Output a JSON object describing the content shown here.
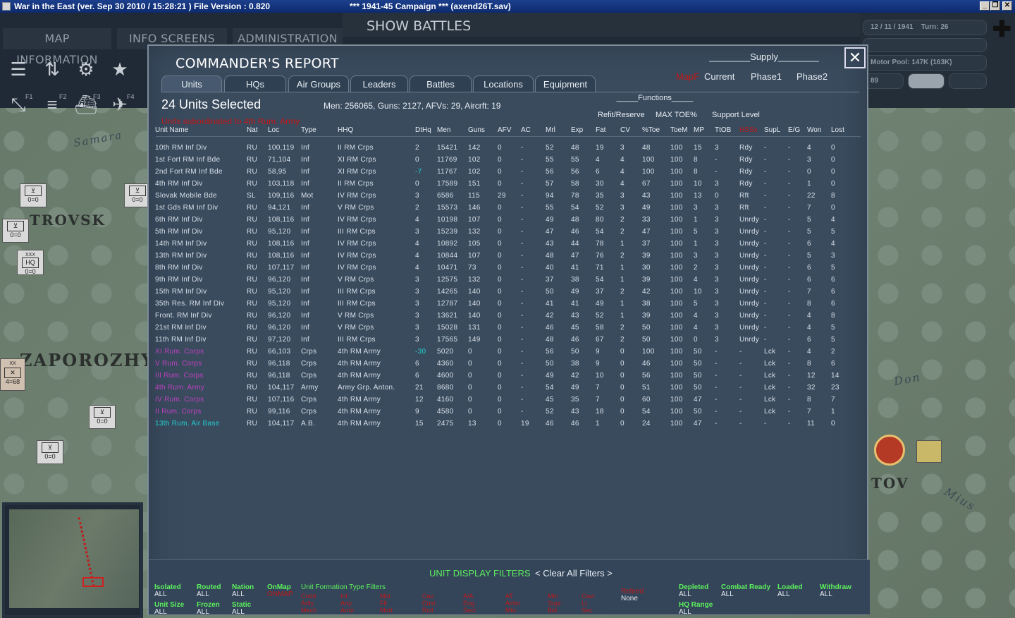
{
  "window": {
    "title": "War in the East (ver. Sep 30 2010 / 15:28:21 )   File Version : 0.820",
    "subtitle": "***   1941-45 Campaign   ***    (axend26T.sav)"
  },
  "nav": {
    "map_info": "MAP INFORMATION",
    "info_screens": "INFO SCREENS",
    "administration": "ADMINISTRATION",
    "show_battles": "SHOW BATTLES"
  },
  "status": {
    "date": "12 / 11 / 1941",
    "turn": "Turn: 26",
    "motor_pool": "Motor Pool: 147K (163K)",
    "value89": "89"
  },
  "function_keys": [
    "F1",
    "F2",
    "F3",
    "F4"
  ],
  "map": {
    "labels": [
      "Samara",
      "TROVSK",
      "ZAPOROZHY",
      "Don",
      "TOV",
      "Mius"
    ],
    "counters": [
      "0=0",
      "0=0",
      "0=0",
      "0=0",
      "0=0",
      "0=0",
      "4=68"
    ],
    "counter_codes": [
      "XXX",
      "HQ",
      "XX"
    ]
  },
  "dialog": {
    "title": "COMMANDER'S REPORT",
    "close": "✕",
    "supply_header": "________Supply________",
    "supply_options": {
      "mapf": "MapF",
      "current": "Current",
      "phase1": "Phase1",
      "phase2": "Phase2"
    },
    "tabs": [
      "Units",
      "HQs",
      "Air Groups",
      "Leaders",
      "Battles",
      "Locations",
      "Equipment"
    ],
    "selected_count": "24 Units Selected",
    "summary": "Men: 256065, Guns: 2127, AFVs: 29, Aircrft: 19",
    "red_message": "Units subordinated to 4th Rum. Army",
    "functions_header": "_____Functions_____",
    "group_headers": {
      "refit": "Refit/Reserve",
      "maxtoe": "MAX TOE%",
      "support": "Support Level"
    },
    "columns": [
      "Unit Name",
      "Nat",
      "Loc",
      "Type",
      "HHQ",
      "DtHq",
      "Men",
      "Guns",
      "AFV",
      "AC",
      "Mrl",
      "Exp",
      "Fat",
      "CV",
      "%Toe",
      "ToeM",
      "MP",
      "TtOB",
      "HSSx",
      "SupL",
      "E/G",
      "Won",
      "Lost"
    ]
  },
  "units": [
    [
      "10th RM Inf Div",
      "RU",
      "100,119",
      "Inf",
      "II RM Crps",
      "2",
      "15421",
      "142",
      "0",
      "-",
      "52",
      "48",
      "19",
      "3",
      "48",
      "100",
      "15",
      "3",
      "Rdy",
      "-",
      "-",
      "4",
      "0"
    ],
    [
      "1st Fort RM Inf Bde",
      "RU",
      "71,104",
      "Inf",
      "XI RM Crps",
      "0",
      "11769",
      "102",
      "0",
      "-",
      "55",
      "55",
      "4",
      "4",
      "100",
      "100",
      "8",
      "-",
      "Rdy",
      "-",
      "-",
      "3",
      "0"
    ],
    [
      "2nd Fort RM Inf Bde",
      "RU",
      "58,95",
      "Inf",
      "XI RM Crps",
      "-7",
      "11767",
      "102",
      "0",
      "-",
      "56",
      "56",
      "6",
      "4",
      "100",
      "100",
      "8",
      "-",
      "Rdy",
      "-",
      "-",
      "0",
      "0"
    ],
    [
      "4th RM Inf Div",
      "RU",
      "103,118",
      "Inf",
      "II RM Crps",
      "0",
      "17589",
      "151",
      "0",
      "-",
      "57",
      "58",
      "30",
      "4",
      "67",
      "100",
      "10",
      "3",
      "Rdy",
      "-",
      "-",
      "1",
      "0"
    ],
    [
      "Slovak Mobile Bde",
      "SL",
      "109,116",
      "Mot",
      "IV RM Crps",
      "3",
      "6586",
      "115",
      "29",
      "-",
      "94",
      "78",
      "35",
      "3",
      "43",
      "100",
      "13",
      "0",
      "Rft",
      "-",
      "-",
      "22",
      "8"
    ],
    [
      "1st Gds RM Inf Div",
      "RU",
      "94,121",
      "Inf",
      "V RM Crps",
      "2",
      "15573",
      "146",
      "0",
      "-",
      "55",
      "54",
      "52",
      "3",
      "49",
      "100",
      "3",
      "3",
      "Rft",
      "-",
      "-",
      "7",
      "0"
    ],
    [
      "6th RM Inf Div",
      "RU",
      "108,116",
      "Inf",
      "IV RM Crps",
      "4",
      "10198",
      "107",
      "0",
      "-",
      "49",
      "48",
      "80",
      "2",
      "33",
      "100",
      "1",
      "3",
      "Unrdy",
      "-",
      "-",
      "5",
      "4"
    ],
    [
      "5th RM Inf Div",
      "RU",
      "95,120",
      "Inf",
      "III RM Crps",
      "3",
      "15239",
      "132",
      "0",
      "-",
      "47",
      "46",
      "54",
      "2",
      "47",
      "100",
      "5",
      "3",
      "Unrdy",
      "-",
      "-",
      "5",
      "5"
    ],
    [
      "14th RM Inf Div",
      "RU",
      "108,116",
      "Inf",
      "IV RM Crps",
      "4",
      "10892",
      "105",
      "0",
      "-",
      "43",
      "44",
      "78",
      "1",
      "37",
      "100",
      "1",
      "3",
      "Unrdy",
      "-",
      "-",
      "6",
      "4"
    ],
    [
      "13th RM Inf Div",
      "RU",
      "108,116",
      "Inf",
      "IV RM Crps",
      "4",
      "10844",
      "107",
      "0",
      "-",
      "48",
      "47",
      "76",
      "2",
      "39",
      "100",
      "3",
      "3",
      "Unrdy",
      "-",
      "-",
      "5",
      "3"
    ],
    [
      "8th RM Inf Div",
      "RU",
      "107,117",
      "Inf",
      "IV RM Crps",
      "4",
      "10471",
      "73",
      "0",
      "-",
      "40",
      "41",
      "71",
      "1",
      "30",
      "100",
      "2",
      "3",
      "Unrdy",
      "-",
      "-",
      "6",
      "5"
    ],
    [
      "9th RM Inf Div",
      "RU",
      "96,120",
      "Inf",
      "V RM Crps",
      "3",
      "12575",
      "132",
      "0",
      "-",
      "37",
      "38",
      "54",
      "1",
      "39",
      "100",
      "4",
      "3",
      "Unrdy",
      "-",
      "-",
      "6",
      "6"
    ],
    [
      "15th RM Inf Div",
      "RU",
      "95,120",
      "Inf",
      "III RM Crps",
      "3",
      "14265",
      "140",
      "0",
      "-",
      "50",
      "49",
      "37",
      "2",
      "42",
      "100",
      "10",
      "3",
      "Unrdy",
      "-",
      "-",
      "7",
      "6"
    ],
    [
      "35th Res. RM Inf Div",
      "RU",
      "95,120",
      "Inf",
      "III RM Crps",
      "3",
      "12787",
      "140",
      "0",
      "-",
      "41",
      "41",
      "49",
      "1",
      "38",
      "100",
      "5",
      "3",
      "Unrdy",
      "-",
      "-",
      "8",
      "6"
    ],
    [
      "Front. RM Inf Div",
      "RU",
      "96,120",
      "Inf",
      "V RM Crps",
      "3",
      "13621",
      "140",
      "0",
      "-",
      "42",
      "43",
      "52",
      "1",
      "39",
      "100",
      "4",
      "3",
      "Unrdy",
      "-",
      "-",
      "4",
      "8"
    ],
    [
      "21st RM Inf Div",
      "RU",
      "96,120",
      "Inf",
      "V RM Crps",
      "3",
      "15028",
      "131",
      "0",
      "-",
      "46",
      "45",
      "58",
      "2",
      "50",
      "100",
      "4",
      "3",
      "Unrdy",
      "-",
      "-",
      "4",
      "5"
    ],
    [
      "11th RM Inf Div",
      "RU",
      "97,120",
      "Inf",
      "III RM Crps",
      "3",
      "17565",
      "149",
      "0",
      "-",
      "48",
      "46",
      "67",
      "2",
      "50",
      "100",
      "0",
      "3",
      "Unrdy",
      "-",
      "-",
      "6",
      "5"
    ],
    [
      "XI Rum. Corps",
      "RU",
      "66,103",
      "Crps",
      "4th RM Army",
      "-30",
      "5020",
      "0",
      "0",
      "-",
      "56",
      "50",
      "9",
      "0",
      "100",
      "100",
      "50",
      "-",
      "-",
      "Lck",
      "-",
      "4",
      "2"
    ],
    [
      "V Rum. Corps",
      "RU",
      "96,118",
      "Crps",
      "4th RM Army",
      "6",
      "4360",
      "0",
      "0",
      "-",
      "50",
      "38",
      "9",
      "0",
      "46",
      "100",
      "50",
      "-",
      "-",
      "Lck",
      "-",
      "8",
      "6"
    ],
    [
      "III Rum. Corps",
      "RU",
      "96,118",
      "Crps",
      "4th RM Army",
      "6",
      "4600",
      "0",
      "0",
      "-",
      "49",
      "42",
      "10",
      "0",
      "56",
      "100",
      "50",
      "-",
      "-",
      "Lck",
      "-",
      "12",
      "14"
    ],
    [
      "4th Rum. Army",
      "RU",
      "104,117",
      "Army",
      "Army Grp. Anton.",
      "21",
      "8680",
      "0",
      "0",
      "-",
      "54",
      "49",
      "7",
      "0",
      "51",
      "100",
      "50",
      "-",
      "-",
      "Lck",
      "-",
      "32",
      "23"
    ],
    [
      "IV Rum. Corps",
      "RU",
      "107,116",
      "Crps",
      "4th RM Army",
      "12",
      "4160",
      "0",
      "0",
      "-",
      "45",
      "35",
      "7",
      "0",
      "60",
      "100",
      "47",
      "-",
      "-",
      "Lck",
      "-",
      "8",
      "7"
    ],
    [
      "II Rum. Corps",
      "RU",
      "99,116",
      "Crps",
      "4th RM Army",
      "9",
      "4580",
      "0",
      "0",
      "-",
      "52",
      "43",
      "18",
      "0",
      "54",
      "100",
      "50",
      "-",
      "-",
      "Lck",
      "-",
      "7",
      "1"
    ],
    [
      "13th Rum. Air Base",
      "RU",
      "104,117",
      "A.B.",
      "4th RM Army",
      "15",
      "2475",
      "13",
      "0",
      "19",
      "46",
      "46",
      "1",
      "0",
      "24",
      "100",
      "47",
      "-",
      "-",
      "-",
      "-",
      "11",
      "0"
    ]
  ],
  "unit_name_colors": [
    "#d8e0e8",
    "#d8e0e8",
    "#d8e0e8",
    "#d8e0e8",
    "#d8e0e8",
    "#d8e0e8",
    "#d8e0e8",
    "#d8e0e8",
    "#d8e0e8",
    "#d8e0e8",
    "#d8e0e8",
    "#d8e0e8",
    "#d8e0e8",
    "#d8e0e8",
    "#d8e0e8",
    "#d8e0e8",
    "#d8e0e8",
    "#c040c0",
    "#c040c0",
    "#c040c0",
    "#c040c0",
    "#c040c0",
    "#c040c0",
    "#20d0d0"
  ],
  "dthq_colors": {
    "2": "#20d0d0",
    "17": "#20d0d0"
  },
  "filters": {
    "title": "UNIT DISPLAY FILTERS",
    "clear": "< Clear All Filters >",
    "groups": [
      {
        "label": "Isolated",
        "value": "ALL"
      },
      {
        "label": "Routed",
        "value": "ALL"
      },
      {
        "label": "Nation",
        "value": "ALL"
      },
      {
        "label": "OnMap",
        "value": "ONMAP"
      },
      {
        "label": "Unit Size",
        "value": "ALL"
      },
      {
        "label": "Frozen",
        "value": "ALL"
      },
      {
        "label": "Static",
        "value": "ALL"
      },
      {
        "label": "Depleted",
        "value": "ALL"
      },
      {
        "label": "Combat Ready",
        "value": "ALL"
      },
      {
        "label": "Loaded",
        "value": "ALL"
      },
      {
        "label": "Withdraw",
        "value": "ALL"
      },
      {
        "label": "HQ Range",
        "value": "ALL"
      }
    ],
    "formation_header": "Unit  Formation  Type  Filters",
    "red_columns": [
      "Cmbt\nArtly\nMech",
      "Inf\nArty\nArmr",
      "Mot\nFlt\nMort",
      "Cav\nCnst\nRctl",
      "A/A\nEng\nSecr",
      "AT\nAirbn\nMtn",
      "Mtn\nSupr\nBld",
      "Cavr\nLt\nSec",
      "Retired"
    ],
    "retired_value": "None"
  },
  "colors": {
    "accent_green": "#5cf05c",
    "red": "#c01818",
    "purple": "#c040c0",
    "cyan": "#20d0d0",
    "panel": "#3a4b5e"
  }
}
